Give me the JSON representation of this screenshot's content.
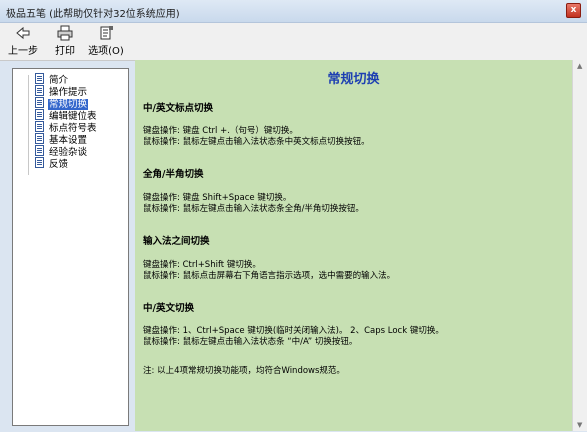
{
  "window": {
    "title": "极品五笔 (此帮助仅针对32位系统应用)",
    "close_glyph": "x"
  },
  "toolbar": {
    "back_label": "上一步",
    "print_label": "打印",
    "options_label": "选项(O)"
  },
  "tree": {
    "items": [
      {
        "label": "简介"
      },
      {
        "label": "操作提示"
      },
      {
        "label": "常规切换"
      },
      {
        "label": "编辑键位表"
      },
      {
        "label": "标点符号表"
      },
      {
        "label": "基本设置"
      },
      {
        "label": "经验杂谈"
      },
      {
        "label": "反馈"
      }
    ],
    "selected_index": 2
  },
  "content": {
    "title": "常规切换",
    "sections": [
      {
        "heading": "中/英文标点切换",
        "lines": [
          "键盘操作: 键盘 Ctrl +.（句号）键切换。",
          "鼠标操作: 鼠标左键点击输入法状态条中英文标点切换按钮。"
        ]
      },
      {
        "heading": "全角/半角切换",
        "lines": [
          "键盘操作: 键盘 Shift+Space 键切换。",
          "鼠标操作: 鼠标左键点击输入法状态条全角/半角切换按钮。"
        ]
      },
      {
        "heading": "输入法之间切换",
        "lines": [
          "键盘操作: Ctrl+Shift 键切换。",
          "鼠标操作: 鼠标点击屏幕右下角语言指示选项，选中需要的输入法。"
        ]
      },
      {
        "heading": "中/英文切换",
        "lines": [
          "键盘操作:  1、Ctrl+Space 键切换(临时关闭输入法)。 2、Caps Lock 键切换。",
          "鼠标操作: 鼠标左键点击输入法状态条 “中/A” 切换按钮。"
        ]
      }
    ],
    "note": "注: 以上4项常规切换功能项，均符合Windows规范。"
  },
  "colors": {
    "content_bg": "#c7e0b3",
    "title_blue": "#1d3fb2",
    "selection": "#3366cc"
  }
}
